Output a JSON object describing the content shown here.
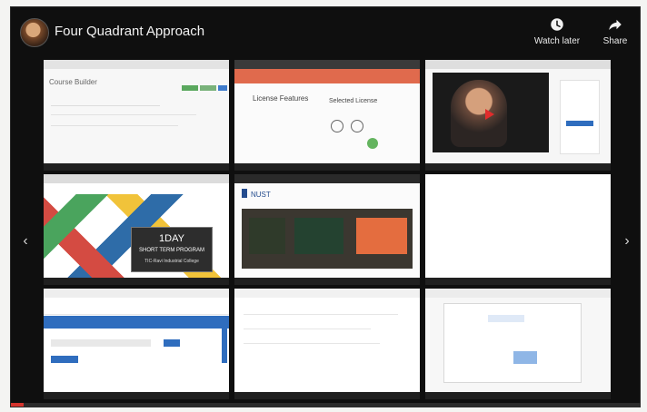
{
  "header": {
    "title": "Four Quadrant Approach",
    "watch_later_label": "Watch later",
    "share_label": "Share"
  },
  "tiles": {
    "t1": {
      "heading": "Course Builder"
    },
    "t2": {
      "heading": "License Features",
      "subheading": "Selected License"
    },
    "t3": {},
    "t4": {
      "line1": "1DAY",
      "line2": "SHORT TERM PROGRAM",
      "line3": "TIC-Ravi Industrial College"
    },
    "t5": {
      "brand": "NUST"
    },
    "t6": {},
    "t7": {},
    "t8": {},
    "t9": {}
  },
  "controls": {
    "prev_glyph": "‹",
    "next_glyph": "›"
  },
  "progress": {
    "value": 0.02
  },
  "icons": {
    "clock": "clock-icon",
    "share": "share-arrow-icon",
    "avatar": "avatar-image"
  },
  "colors": {
    "background": "#0f0f0f",
    "accent_red": "#d5342d",
    "blue": "#2f6dbe",
    "green": "#47a34a"
  }
}
